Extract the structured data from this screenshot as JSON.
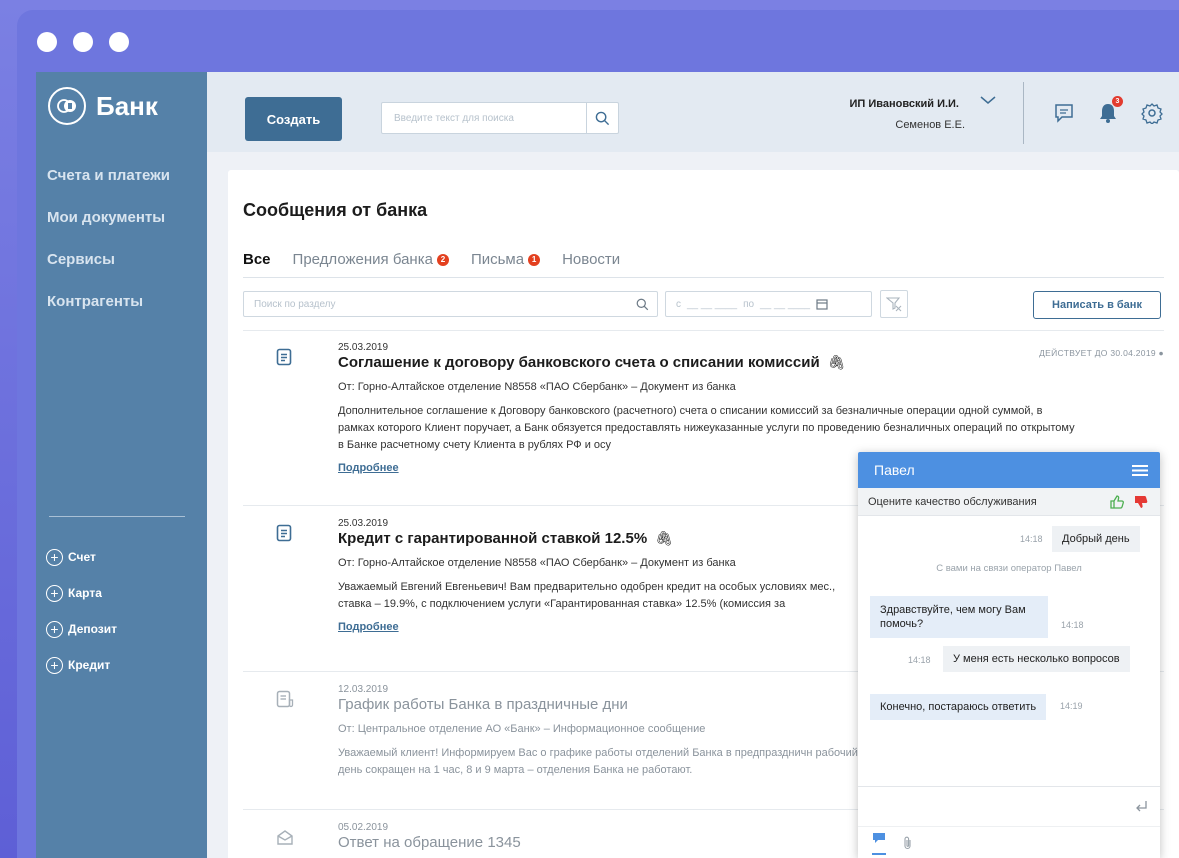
{
  "brand": {
    "name": "Банк"
  },
  "sidebar": {
    "items": [
      {
        "label": "Счета и платежи"
      },
      {
        "label": "Мои документы"
      },
      {
        "label": "Сервисы"
      },
      {
        "label": "Контрагенты"
      }
    ],
    "actions": [
      {
        "label": "Счет"
      },
      {
        "label": "Карта"
      },
      {
        "label": "Депозит"
      },
      {
        "label": "Кредит"
      }
    ]
  },
  "header": {
    "create_label": "Создать",
    "search_placeholder": "Введите текст для поиска",
    "user_name": "ИП Ивановский И.И.",
    "user_sub": "Семенов Е.Е.",
    "notification_count": "3"
  },
  "page": {
    "title": "Сообщения от банка"
  },
  "tabs": [
    {
      "label": "Все",
      "badge": ""
    },
    {
      "label": "Предложения банка",
      "badge": "2"
    },
    {
      "label": "Письма",
      "badge": "1"
    },
    {
      "label": "Новости",
      "badge": ""
    }
  ],
  "filters": {
    "search_placeholder": "Поиск по разделу",
    "date_from": "с",
    "date_to": "по",
    "write_label": "Написать в банк"
  },
  "messages": [
    {
      "date": "25.03.2019",
      "title": "Соглашение к договору банковского счета о списании комиссий",
      "from": "От: Горно-Алтайское отделение N8558 «ПАО Сбербанк» – Документ из банка",
      "text": "Дополнительное соглашение  к Договору банковского (расчетного) счета о списании комиссий за безналичные операции одной суммой, в рамках которого Клиент поручает, а Банк обязуется предоставлять нижеуказанные услуги по проведению безналичных операций по открытому в Банке расчетному счету Клиента в рублях РФ и осу",
      "more": "Подробнее",
      "valid": "ДЕЙСТВУЕТ ДО 30.04.2019"
    },
    {
      "date": "25.03.2019",
      "title": "Кредит с гарантированной ставкой 12.5%",
      "from": "От: Горно-Алтайское отделение N8558 «ПАО Сбербанк» – Документ из банка",
      "text": "Уважаемый Евгений Евгеньевич! Вам предварительно одобрен кредит на особых условиях мес., ставка – 19.9%, с подключением услуги «Гарантированная ставка» 12.5% (комиссия за",
      "more": "Подробнее"
    },
    {
      "date": "12.03.2019",
      "title": "График работы Банка в праздничные дни",
      "from": "От: Центральное отделение АО «Банк» – Информационное сообщение",
      "text": "Уважаемый клиент! Информируем Вас о графике работы отделений Банка в предпраздничн рабочий день сокращен на 1 час, 8 и 9 марта – отделения Банка не работают."
    },
    {
      "date": "05.02.2019",
      "title": "Ответ на обращение 1345"
    }
  ],
  "chat": {
    "operator": "Павел",
    "rate_label": "Оцените качество обслуживания",
    "messages": [
      {
        "time": "14:18",
        "text": "Добрый день"
      },
      {
        "system": "С вами на связи оператор Павел"
      },
      {
        "text": "Здравствуйте, чем могу Вам помочь?",
        "time": "14:18"
      },
      {
        "time": "14:18",
        "text": "У меня есть несколько вопросов"
      },
      {
        "text": "Конечно, постараюсь ответить",
        "time": "14:19"
      }
    ]
  }
}
